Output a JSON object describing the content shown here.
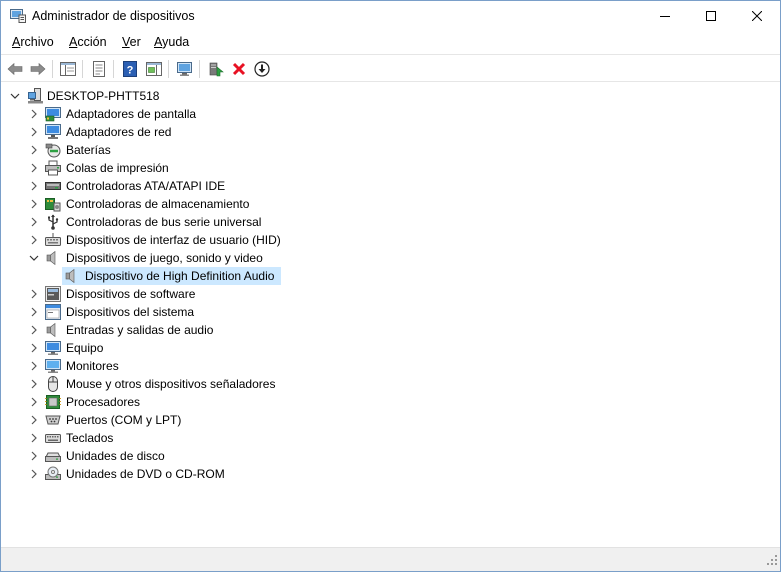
{
  "window": {
    "title": "Administrador de dispositivos"
  },
  "menu": {
    "items": [
      {
        "accel": "A",
        "rest": "rchivo"
      },
      {
        "accel": "A",
        "rest": "cción"
      },
      {
        "accel": "V",
        "rest": "er"
      },
      {
        "accel": "A",
        "rest": "yuda"
      }
    ]
  },
  "tree": {
    "root": "DESKTOP-PHTT518",
    "categories": [
      {
        "label": "Adaptadores de pantalla",
        "icon": "display-adapter-icon"
      },
      {
        "label": "Adaptadores de red",
        "icon": "network-adapter-icon"
      },
      {
        "label": "Baterías",
        "icon": "battery-icon"
      },
      {
        "label": "Colas de impresión",
        "icon": "printer-icon"
      },
      {
        "label": "Controladoras ATA/ATAPI IDE",
        "icon": "ide-controller-icon"
      },
      {
        "label": "Controladoras de almacenamiento",
        "icon": "storage-controller-icon"
      },
      {
        "label": "Controladoras de bus serie universal",
        "icon": "usb-icon"
      },
      {
        "label": "Dispositivos de interfaz de usuario (HID)",
        "icon": "hid-icon"
      },
      {
        "label": "Dispositivos de juego, sonido y video",
        "icon": "speaker-icon",
        "expanded": true,
        "children": [
          {
            "label": "Dispositivo de High Definition Audio",
            "icon": "speaker-icon",
            "selected": true
          }
        ]
      },
      {
        "label": "Dispositivos de software",
        "icon": "software-device-icon"
      },
      {
        "label": "Dispositivos del sistema",
        "icon": "system-device-icon"
      },
      {
        "label": "Entradas y salidas de audio",
        "icon": "speaker-icon"
      },
      {
        "label": "Equipo",
        "icon": "computer-icon"
      },
      {
        "label": "Monitores",
        "icon": "monitor-icon"
      },
      {
        "label": "Mouse y otros dispositivos señaladores",
        "icon": "mouse-icon"
      },
      {
        "label": "Procesadores",
        "icon": "processor-icon"
      },
      {
        "label": "Puertos (COM y LPT)",
        "icon": "port-icon"
      },
      {
        "label": "Teclados",
        "icon": "keyboard-icon"
      },
      {
        "label": "Unidades de disco",
        "icon": "disk-drive-icon"
      },
      {
        "label": "Unidades de DVD o CD-ROM",
        "icon": "dvd-drive-icon"
      }
    ]
  },
  "colors": {
    "selection": "#cce8ff",
    "accent": "#0078d7",
    "delete_red": "#e81123"
  }
}
